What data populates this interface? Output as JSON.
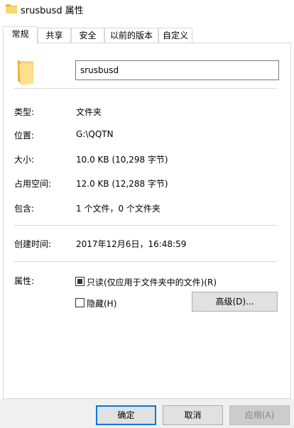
{
  "window": {
    "title": "srusbusd 属性",
    "icon": "folder-icon"
  },
  "tabs": [
    {
      "label": "常规",
      "active": true
    },
    {
      "label": "共享",
      "active": false
    },
    {
      "label": "安全",
      "active": false
    },
    {
      "label": "以前的版本",
      "active": false
    },
    {
      "label": "自定义",
      "active": false
    }
  ],
  "general": {
    "name_value": "srusbusd",
    "folder_icon": "folder-icon",
    "rows": [
      {
        "label": "类型:",
        "value": "文件夹"
      },
      {
        "label": "位置:",
        "value": "G:\\QQTN"
      },
      {
        "label": "大小:",
        "value": "10.0 KB (10,298 字节)"
      },
      {
        "label": "占用空间:",
        "value": "12.0 KB (12,288 字节)"
      },
      {
        "label": "包含:",
        "value": "1 个文件，0 个文件夹"
      }
    ],
    "created_label": "创建时间:",
    "created_value": "2017年12月6日，16:48:59",
    "attributes_label": "属性:",
    "readonly_label": "只读(仅应用于文件夹中的文件)(R)",
    "readonly_checked": true,
    "hidden_label": "隐藏(H)",
    "hidden_checked": false,
    "advanced_button": "高级(D)..."
  },
  "buttons": {
    "ok": "确定",
    "cancel": "取消",
    "apply": "应用(A)"
  },
  "colors": {
    "folder": "#f8d775",
    "folder_dark": "#e8b23a",
    "accent": "#0078d7"
  }
}
